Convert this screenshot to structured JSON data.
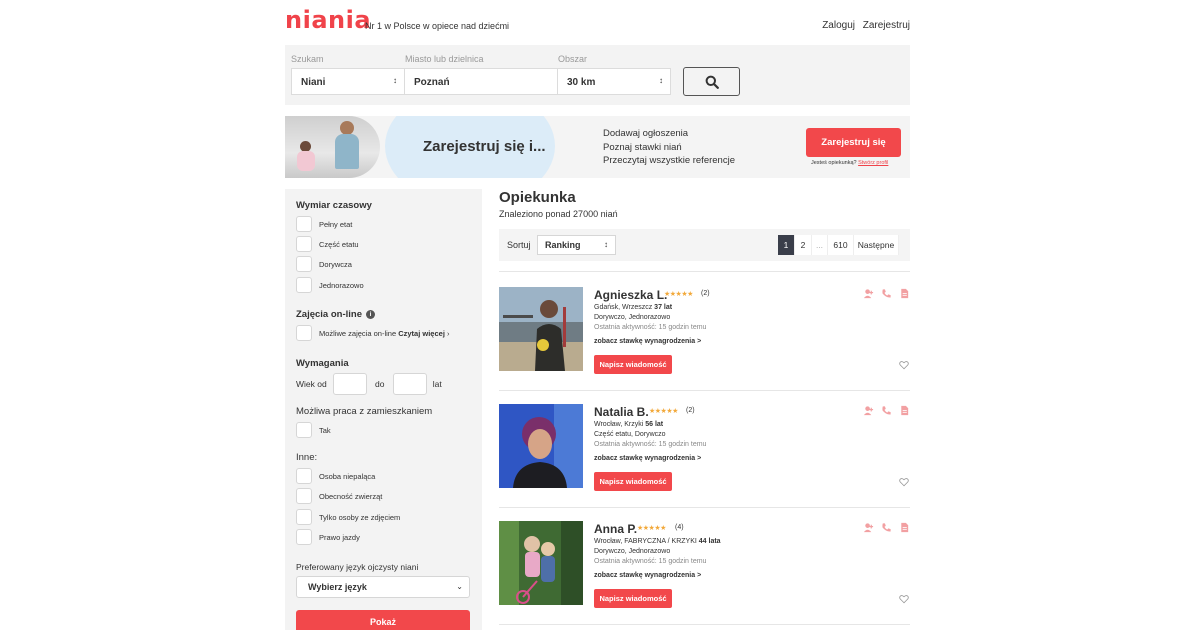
{
  "header": {
    "logo": "niania",
    "tagline": "Nr 1 w Polsce w opiece nad dziećmi",
    "login": "Zaloguj",
    "register": "Zarejestruj"
  },
  "search": {
    "labels": {
      "looking_for": "Szukam",
      "city": "Miasto lub dzielnica",
      "area": "Obszar"
    },
    "looking_for_value": "Niani",
    "city_value": "Poznań",
    "area_value": "30 km",
    "button_icon": "search-icon"
  },
  "promo": {
    "title": "Zarejestruj się i...",
    "benefits": [
      "Dodawaj ogłoszenia",
      "Poznaj stawki niań",
      "Przeczytaj wszystkie referencje"
    ],
    "button": "Zarejestruj się",
    "note_text": "Jesteś opiekunką?",
    "note_link": "Stwórz profil"
  },
  "filters": {
    "time_heading": "Wymiar czasowy",
    "time_options": [
      "Pełny etat",
      "Część etatu",
      "Dorywcza",
      "Jednorazowo"
    ],
    "online_heading": "Zajęcia on-line",
    "online_option": "Możliwe zajęcia on-line",
    "online_more": "Czytaj więcej",
    "requirements_heading": "Wymagania",
    "age_from": "Wiek od",
    "age_to": "do",
    "age_unit": "lat",
    "livein_heading": "Możliwa praca z zamieszkaniem",
    "livein_option": "Tak",
    "other_heading": "Inne:",
    "other_options": [
      "Osoba niepaląca",
      "Obecność zwierząt",
      "Tylko osoby ze zdjęciem",
      "Prawo jazdy"
    ],
    "language_heading": "Preferowany język ojczysty niani",
    "language_select": "Wybierz język",
    "show_button": "Pokaż"
  },
  "results": {
    "title": "Opiekunka",
    "count": "Znaleziono ponad 27000 niań",
    "sort_label": "Sortuj",
    "sort_value": "Ranking",
    "pages": [
      "1",
      "2",
      "...",
      "610",
      "Następne"
    ],
    "message_button": "Napisz wiadomość",
    "rates_link": "zobacz stawkę wynagrodzenia >",
    "items": [
      {
        "name": "Agnieszka L.",
        "rating": 5,
        "reviews": "(2)",
        "location": "Gdańsk, Wrzeszcz",
        "age": "37 lat",
        "types": "Dorywczo, Jednorazowo",
        "activity": "Ostatnia aktywność: 15 godzin temu"
      },
      {
        "name": "Natalia B.",
        "rating": 5,
        "reviews": "(2)",
        "location": "Wrocław, Krzyki",
        "age": "56 lat",
        "types": "Część etatu, Dorywczo",
        "activity": "Ostatnia aktywność: 15 godzin temu"
      },
      {
        "name": "Anna P.",
        "rating": 5,
        "reviews": "(4)",
        "location": "Wrocław, FABRYCZNA / KRZYKI",
        "age": "44 lata",
        "types": "Dorywczo, Jednorazowo",
        "activity": "Ostatnia aktywność: 15 godzin temu"
      }
    ]
  },
  "colors": {
    "accent": "#f2484b",
    "pager_active": "#3a3e4a",
    "stars": "#f2a93b",
    "panel": "#f3f3f3"
  }
}
